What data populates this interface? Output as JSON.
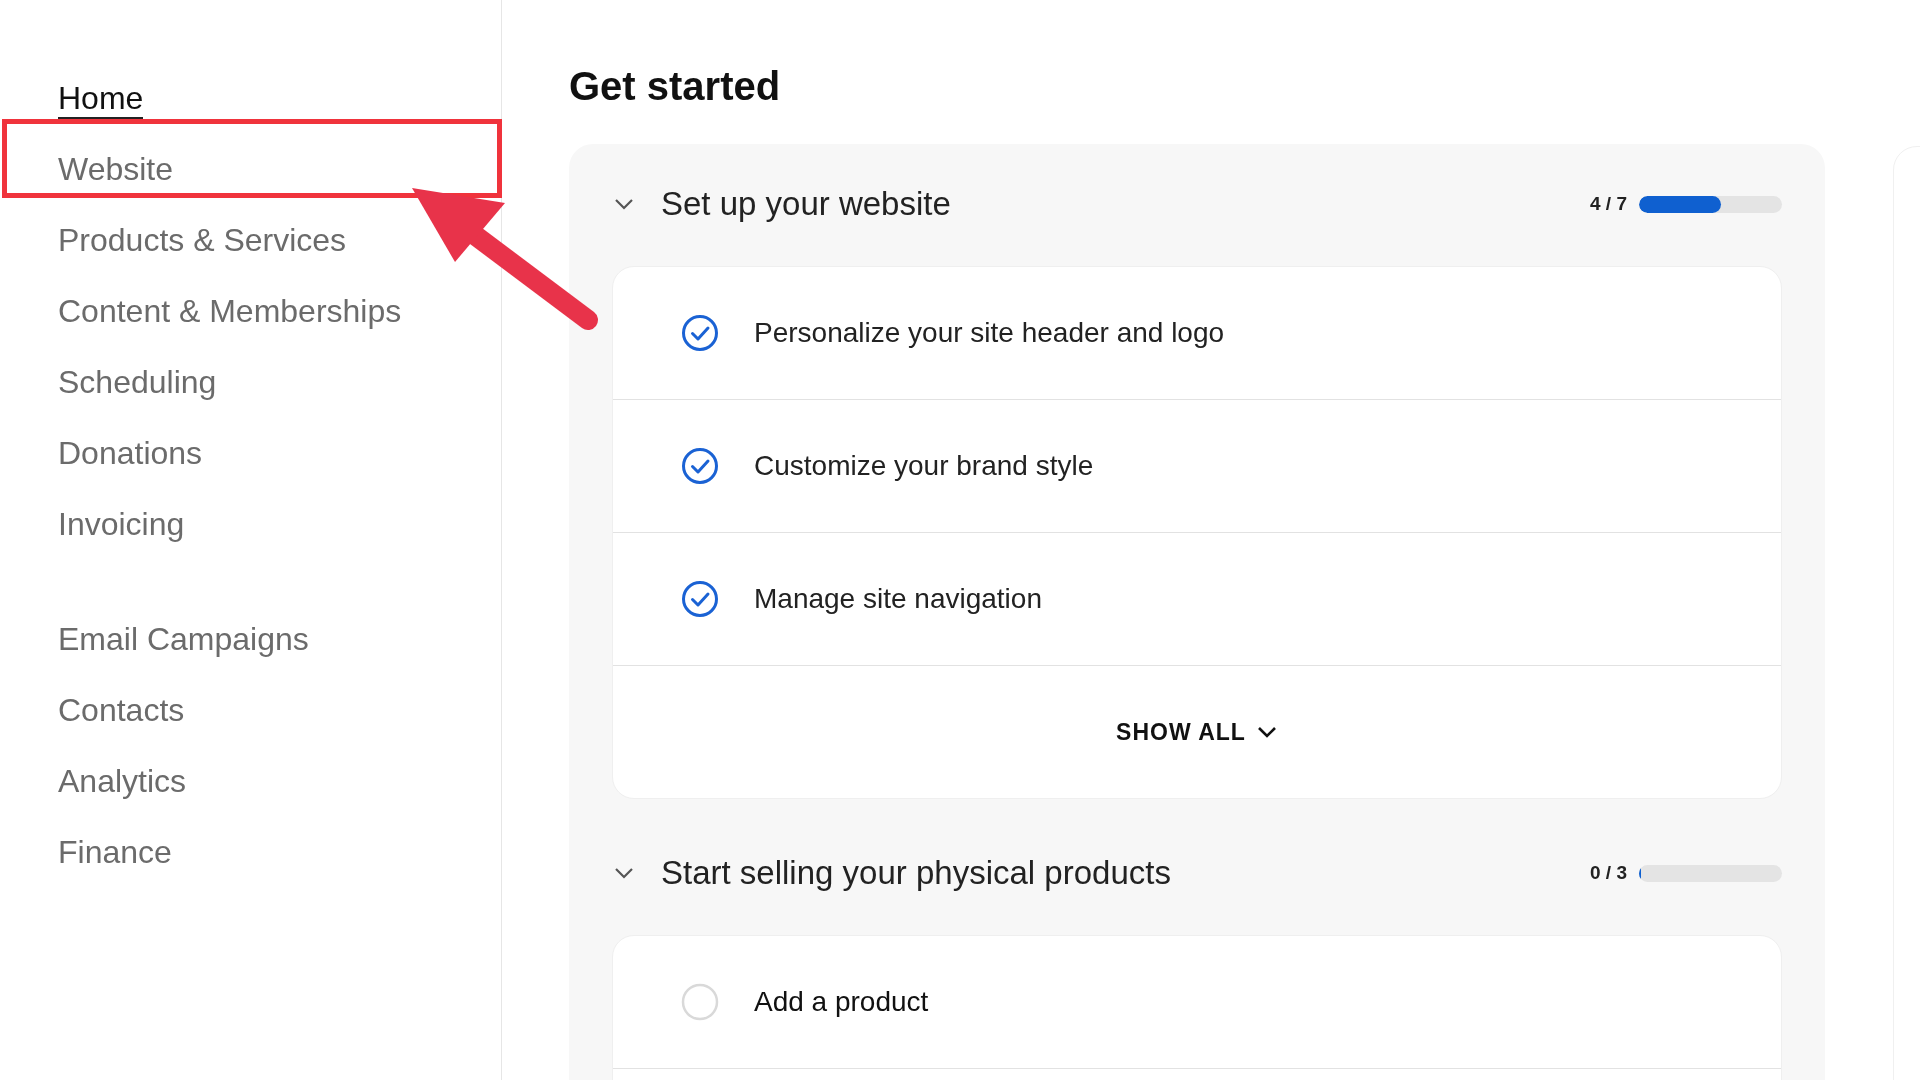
{
  "sidebar": {
    "groups": [
      {
        "items": [
          {
            "label": "Home",
            "selected": true
          },
          {
            "label": "Website",
            "selected": false
          },
          {
            "label": "Products & Services",
            "selected": false
          },
          {
            "label": "Content & Memberships",
            "selected": false
          },
          {
            "label": "Scheduling",
            "selected": false
          },
          {
            "label": "Donations",
            "selected": false
          },
          {
            "label": "Invoicing",
            "selected": false
          }
        ]
      },
      {
        "items": [
          {
            "label": "Email Campaigns",
            "selected": false
          },
          {
            "label": "Contacts",
            "selected": false
          },
          {
            "label": "Analytics",
            "selected": false
          },
          {
            "label": "Finance",
            "selected": false
          }
        ]
      }
    ]
  },
  "main": {
    "title": "Get started",
    "sections": [
      {
        "title": "Set up your website",
        "expanded": true,
        "count": "4 / 7",
        "level": 0.57,
        "tasks": [
          {
            "label": "Personalize your site header and logo",
            "done": true
          },
          {
            "label": "Customize your brand style",
            "done": true
          },
          {
            "label": "Manage site navigation",
            "done": true
          }
        ],
        "show_all": "SHOW ALL"
      },
      {
        "title": "Start selling your physical products",
        "expanded": true,
        "count": "0 / 3",
        "level": 0,
        "tasks": [
          {
            "label": "Add a product",
            "done": false
          }
        ]
      }
    ]
  }
}
